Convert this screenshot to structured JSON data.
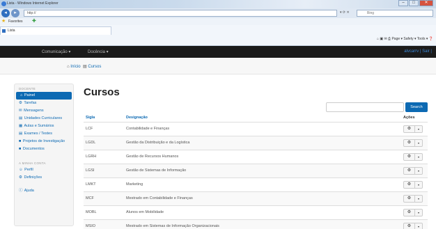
{
  "window": {
    "title": "Lista - Windows Internet Explorer",
    "url": "http://",
    "search_placeholder": "Bing"
  },
  "favorites": {
    "label": "Favorites"
  },
  "tab": {
    "title": "Lista"
  },
  "commandbar": {
    "text": "Page ▾  Safety ▾  Tools ▾"
  },
  "nav": {
    "brand": "",
    "menu1": "Comunicação ▾",
    "menu2": "Docência ▾",
    "user": "alvcarrv | Sair |"
  },
  "breadcrumb": {
    "home": "Início",
    "current": "Cursos"
  },
  "sidebar": {
    "section1": "DOCENTE",
    "items": [
      {
        "icon": "⌂",
        "label": "Painel",
        "active": true
      },
      {
        "icon": "⚙",
        "label": "Tarefas"
      },
      {
        "icon": "✉",
        "label": "Mensagens"
      },
      {
        "icon": "▤",
        "label": "Unidades Curriculares"
      },
      {
        "icon": "▦",
        "label": "Aulas e Sumários"
      },
      {
        "icon": "▤",
        "label": "Exames / Testes"
      },
      {
        "icon": "■",
        "label": "Projetos de Investigação"
      },
      {
        "icon": "■",
        "label": "Documentos"
      }
    ],
    "section2": "A MINHA CONTA",
    "items2": [
      {
        "icon": "☺",
        "label": "Perfil"
      },
      {
        "icon": "⚙",
        "label": "Definições"
      }
    ],
    "help": {
      "icon": "ⓘ",
      "label": "Ajuda"
    }
  },
  "main": {
    "title": "Cursos",
    "search_button": "Search",
    "columns": {
      "sigla": "Sigla",
      "designacao": "Designação",
      "acoes": "Ações"
    },
    "rows": [
      {
        "sigla": "LCF",
        "designacao": "Contabilidade e Finanças"
      },
      {
        "sigla": "LGDL",
        "designacao": "Gestão da Distribuição e da Logística"
      },
      {
        "sigla": "LGRH",
        "designacao": "Gestão de Recursos Humanos"
      },
      {
        "sigla": "LGSI",
        "designacao": "Gestão de Sistemas de Informação"
      },
      {
        "sigla": "LMKT",
        "designacao": "Marketing"
      },
      {
        "sigla": "MCF",
        "designacao": "Mestrado em Contabilidade e Finanças"
      },
      {
        "sigla": "MOBL",
        "designacao": "Alunos em Mobilidade"
      },
      {
        "sigla": "MSIO",
        "designacao": "Mestrado em Sistemas de Informação Organizacionais"
      }
    ],
    "action_icon": "⚙",
    "caret_icon": "▾"
  },
  "colors": {
    "primary": "#0d6ab3",
    "navbar": "#1b1b1b"
  }
}
